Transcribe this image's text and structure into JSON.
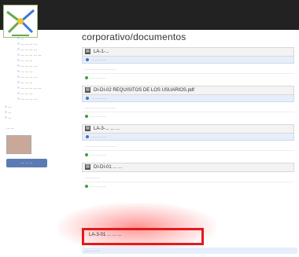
{
  "sidebar": {
    "items": [
      "...",
      "... ... ... ...",
      "... ... ... ...",
      "... ... ... ... ...",
      "... ... ...",
      "... ... ... ...",
      "... ... ...",
      "... ... ... ...",
      "... ... ...",
      "... ... ... ... ...",
      "... ... ...",
      "... ... ... ..."
    ],
    "top_items": [
      "...",
      "...",
      "..."
    ],
    "user_caption": "... ...",
    "user_button": "... ... ..."
  },
  "main": {
    "title": "corporativo/documentos",
    "documents": [
      {
        "name": "LA-1-...",
        "meta": "... ... ... ...",
        "desc": "... ... ... ... ... ... ... ...",
        "actions": "... ... ... ..."
      },
      {
        "name": "DI-DI-02 REQUISITOS DE LOS USUARIOS.pdf",
        "meta": "... ... ... ...",
        "desc": "... ... ... ... ... ... ... ...",
        "actions": "... ... ... ..."
      },
      {
        "name": "LA-3-... ... ...",
        "meta": "... ... ... ...",
        "desc": "... ... ... ... ... ... ... ...",
        "actions": "... ... ... ..."
      },
      {
        "name": "DI-DI-01 ... ...",
        "meta": "... ... ... ...",
        "desc": "... ... ... ...",
        "actions": "... ... ... ..."
      }
    ],
    "highlighted": "LA-3-01 ... ... ...",
    "bottom_meta": "... ... ... ..."
  }
}
